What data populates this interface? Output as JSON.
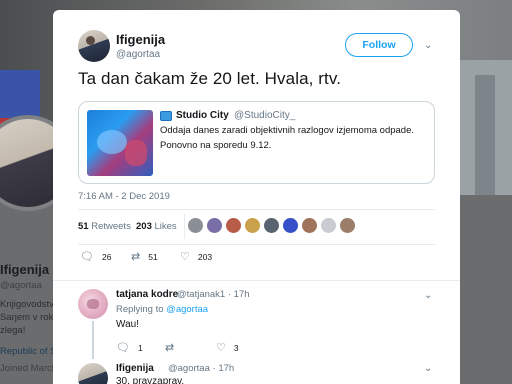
{
  "background_profile": {
    "name": "Ifigenija",
    "handle": "@agortaa",
    "bio_line1": "Knjigovodstvo ti slovenskega",
    "bio_line2": "Sarjem v roke",
    "bio_line3": "zlega!",
    "location": "Republic of Slovenia",
    "joined": "Joined March"
  },
  "tweet": {
    "author_name": "Ifigenija",
    "author_handle": "@agortaa",
    "follow_label": "Follow",
    "text": "Ta dan čakam že 20 let. Hvala, rtv.",
    "quoted": {
      "name": "Studio City",
      "handle": "@StudioCity_",
      "line1": "Oddaja danes zaradi objektivnih razlogov izjemoma odpade.",
      "line2": "Ponovno na sporedu 9.12."
    },
    "timestamp": "7:16 AM - 2 Dec 2019",
    "retweets_count": "51",
    "retweets_label": "Retweets",
    "likes_count": "203",
    "likes_label": "Likes",
    "actions": {
      "reply_count": "26",
      "retweet_count": "51",
      "like_count": "203"
    }
  },
  "replies": [
    {
      "name": "tatjana kodre",
      "handle": "@tatjanak1",
      "time": "17h",
      "replying_to_prefix": "Replying to",
      "replying_to": "@agortaa",
      "text": "Wau!",
      "reply_count": "1",
      "retweet_count": "",
      "like_count": "3"
    },
    {
      "name": "Ifigenija",
      "handle": "@agortaa",
      "time": "17h",
      "text": "30. pravzaprav."
    }
  ],
  "likers_colors": [
    "#8a8f96",
    "#7a6ea8",
    "#b85c4a",
    "#c9a14a",
    "#5a6470",
    "#3550c8",
    "#a0745a",
    "#c8ccd2",
    "#9a7e6a"
  ],
  "icons": {
    "reply": "reply-icon",
    "retweet": "retweet-icon",
    "like": "heart-icon",
    "caret": "chevron-down-icon"
  },
  "colors": {
    "accent": "#1da1f2",
    "text": "#14171a",
    "muted": "#657786"
  }
}
